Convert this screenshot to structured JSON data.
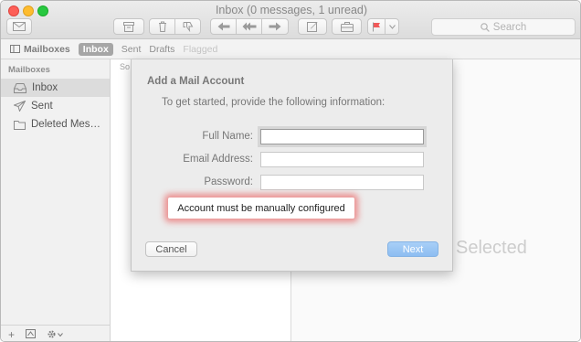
{
  "window": {
    "title": "Inbox (0 messages, 1 unread)"
  },
  "toolbar": {
    "search_placeholder": "Search",
    "buttons": [
      "compose",
      "archive",
      "delete",
      "junk",
      "reply",
      "reply-all",
      "forward",
      "new-note",
      "get-mail",
      "flag"
    ]
  },
  "favorites_bar": {
    "mailboxes_label": "Mailboxes",
    "items": [
      "Inbox",
      "Sent",
      "Drafts",
      "Flagged"
    ],
    "selected": "Inbox"
  },
  "sidebar": {
    "header": "Mailboxes",
    "items": [
      {
        "label": "Inbox",
        "icon": "inbox-icon"
      },
      {
        "label": "Sent",
        "icon": "paper-plane-icon"
      },
      {
        "label": "Deleted Mes…",
        "icon": "folder-icon"
      }
    ],
    "footer": {
      "add": "+"
    }
  },
  "message_list": {
    "sort_label": "So"
  },
  "viewer": {
    "placeholder": "Selected"
  },
  "dialog": {
    "title": "Add a Mail Account",
    "subtitle": "To get started, provide the following information:",
    "fields": [
      {
        "label": "Full Name:",
        "value": ""
      },
      {
        "label": "Email Address:",
        "value": ""
      },
      {
        "label": "Password:",
        "value": ""
      }
    ],
    "error": "Account must be manually configured",
    "cancel_label": "Cancel",
    "next_label": "Next"
  },
  "colors": {
    "accent": "#8dbdf1",
    "error_glow": "#eb4646"
  }
}
